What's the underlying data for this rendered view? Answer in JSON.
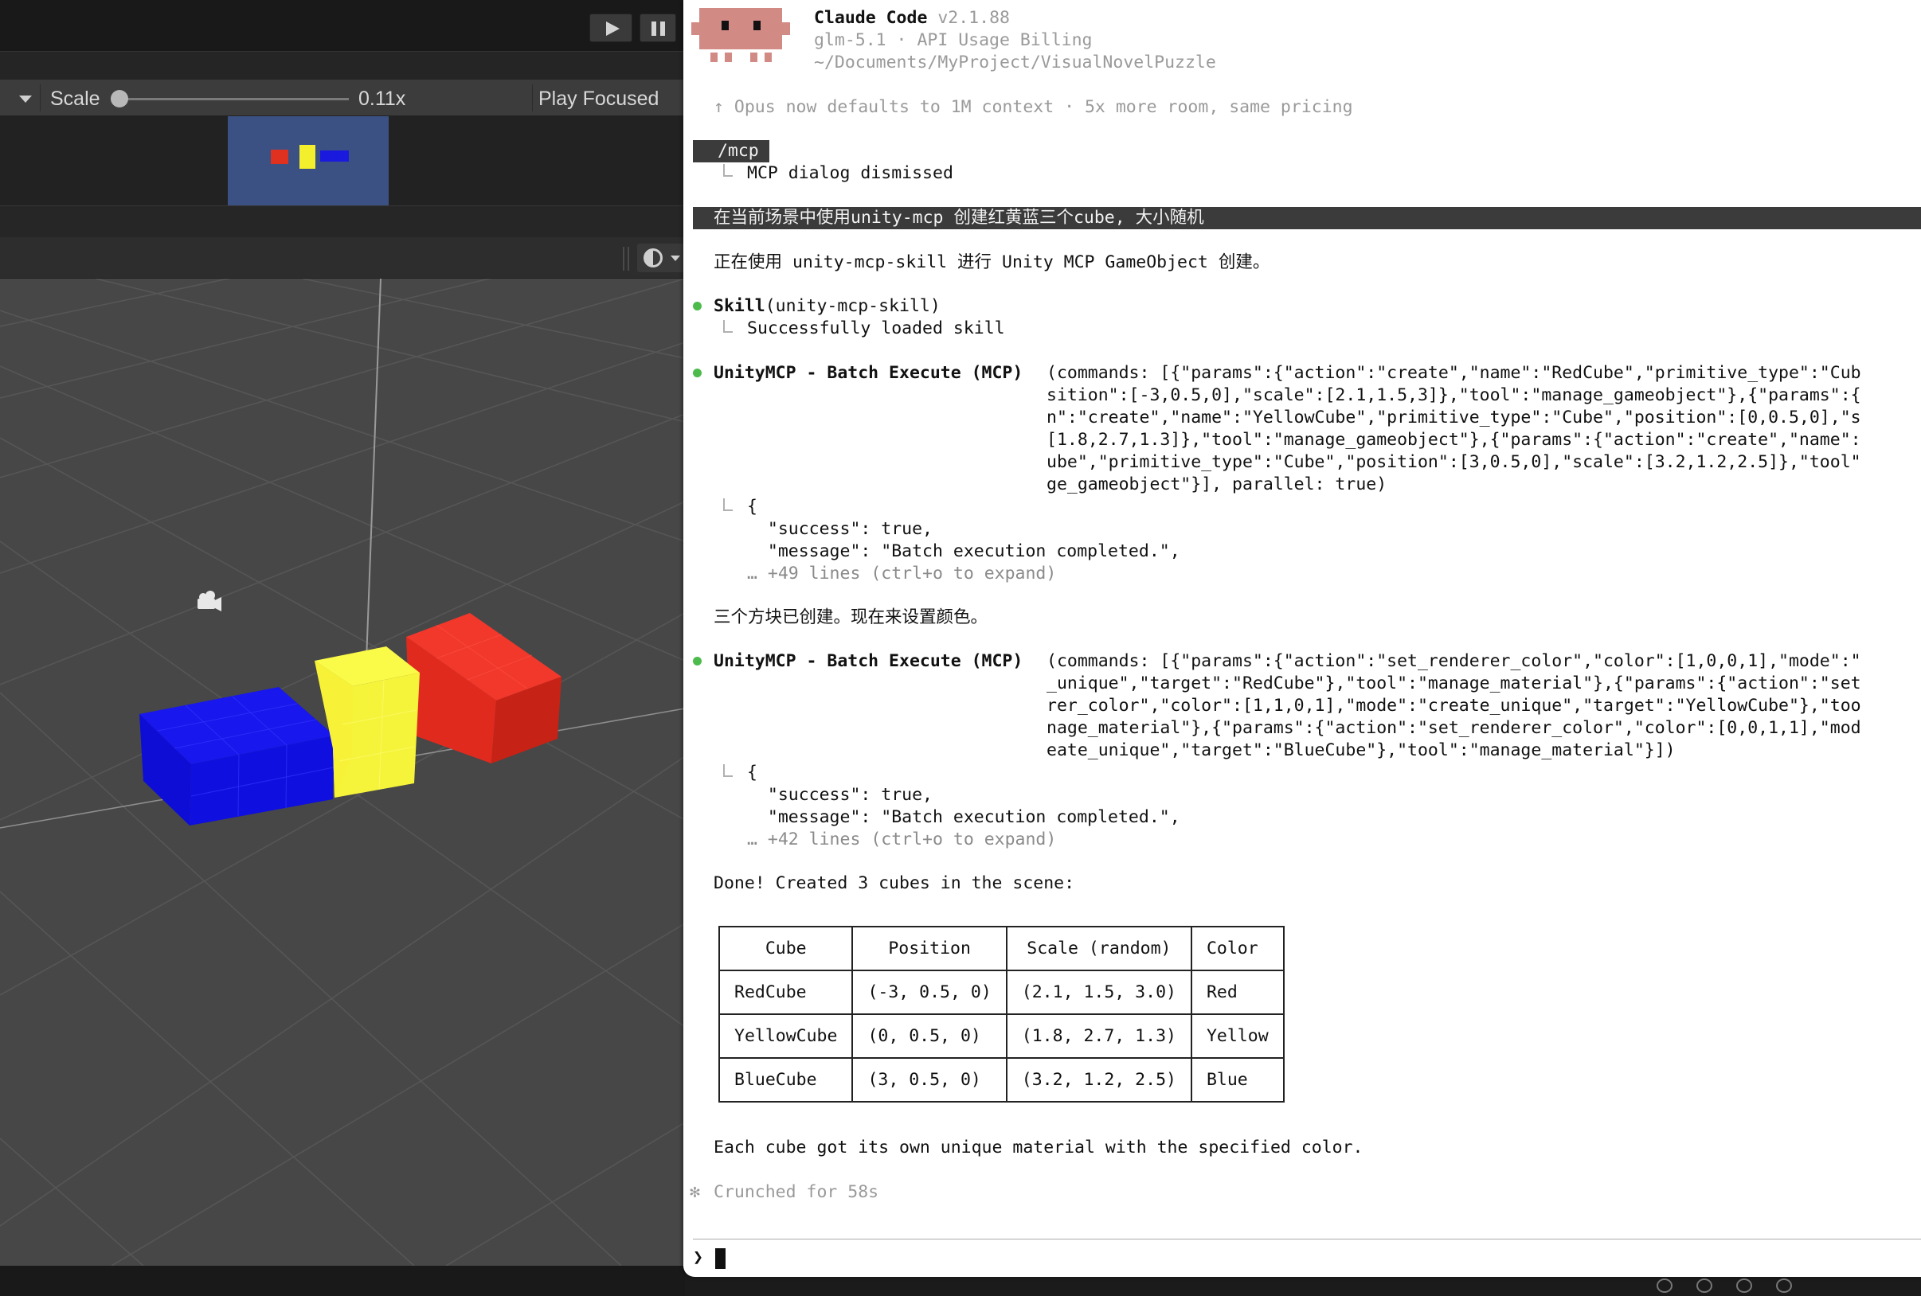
{
  "unity": {
    "toolbar": {
      "play_icon": "play-icon",
      "pause_icon": "pause-icon"
    },
    "game_toolbar": {
      "scale_label": "Scale",
      "scale_value": "0.11x",
      "scale_fraction": 0.03,
      "play_focused": "Play Focused"
    },
    "colors": {
      "red": "#e5301f",
      "yellow": "#f7f238",
      "blue": "#1515e8",
      "preview_bg": "#3b5183",
      "scene_bg": "#474747"
    }
  },
  "terminal": {
    "header": {
      "app_name": "Claude Code",
      "version": "v2.1.88",
      "model_line": "glm-5.1 · API Usage Billing",
      "path": "~/Documents/MyProject/VisualNovelPuzzle"
    },
    "notice": "↑ Opus now defaults to 1M context · 5x more room, same pricing",
    "mcp_command": " /mcp",
    "mcp_result": "MCP dialog dismissed",
    "user_prompt": "在当前场景中使用unity-mcp 创建红黄蓝三个cube, 大小随机",
    "intro_text": "正在使用 unity-mcp-skill 进行 Unity MCP GameObject 创建。",
    "skill_call": {
      "name": "Skill",
      "args": "(unity-mcp-skill)",
      "result": "Successfully loaded skill"
    },
    "batch1": {
      "name": "UnityMCP - Batch Execute (MCP)",
      "args": [
        "(commands: [{\"params\":{\"action\":\"create\",\"name\":\"RedCube\",\"primitive_type\":\"Cub",
        "sition\":[-3,0.5,0],\"scale\":[2.1,1.5,3]},\"tool\":\"manage_gameobject\"},{\"params\":{",
        "n\":\"create\",\"name\":\"YellowCube\",\"primitive_type\":\"Cube\",\"position\":[0,0.5,0],\"s",
        "[1.8,2.7,1.3]},\"tool\":\"manage_gameobject\"},{\"params\":{\"action\":\"create\",\"name\":",
        "ube\",\"primitive_type\":\"Cube\",\"position\":[3,0.5,0],\"scale\":[3.2,1.2,2.5]},\"tool\"",
        "ge_gameobject\"}], parallel: true)"
      ],
      "result": [
        "{",
        "  \"success\": true,",
        "  \"message\": \"Batch execution completed.\","
      ],
      "more": "… +49 lines (ctrl+o to expand)"
    },
    "mid_text": "三个方块已创建。现在来设置颜色。",
    "batch2": {
      "name": "UnityMCP - Batch Execute (MCP)",
      "args": [
        "(commands: [{\"params\":{\"action\":\"set_renderer_color\",\"color\":[1,0,0,1],\"mode\":\"",
        "_unique\",\"target\":\"RedCube\"},\"tool\":\"manage_material\"},{\"params\":{\"action\":\"set",
        "rer_color\",\"color\":[1,1,0,1],\"mode\":\"create_unique\",\"target\":\"YellowCube\"},\"too",
        "nage_material\"},{\"params\":{\"action\":\"set_renderer_color\",\"color\":[0,0,1,1],\"mod",
        "eate_unique\",\"target\":\"BlueCube\"},\"tool\":\"manage_material\"}])"
      ],
      "result": [
        "{",
        "  \"success\": true,",
        "  \"message\": \"Batch execution completed.\","
      ],
      "more": "… +42 lines (ctrl+o to expand)"
    },
    "done_text": "Done! Created 3 cubes in the scene:",
    "table": {
      "headers": [
        "Cube",
        "Position",
        "Scale (random)",
        "Color"
      ],
      "rows": [
        [
          "RedCube",
          "(-3, 0.5, 0)",
          "(2.1, 1.5, 3.0)",
          "Red"
        ],
        [
          "YellowCube",
          "(0, 0.5, 0)",
          "(1.8, 2.7, 1.3)",
          "Yellow"
        ],
        [
          "BlueCube",
          "(3, 0.5, 0)",
          "(3.2, 1.2, 2.5)",
          "Blue"
        ]
      ]
    },
    "summary": "Each cube got its own unique material with the specified color.",
    "status": "Crunched for 58s",
    "status_icon": "✻",
    "prompt_char": "❯"
  }
}
